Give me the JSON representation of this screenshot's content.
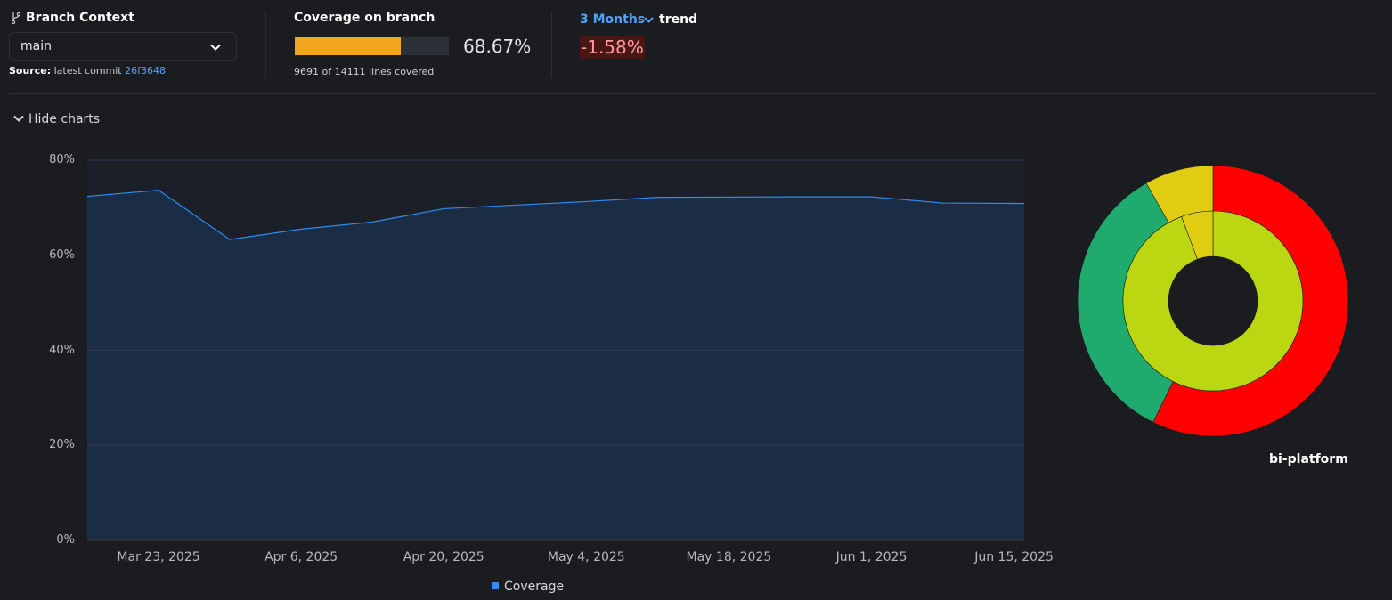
{
  "branch": {
    "title": "Branch Context",
    "selected": "main",
    "source_label": "Source:",
    "source_text": "latest commit",
    "commit": "26f3648"
  },
  "coverage": {
    "title": "Coverage on branch",
    "percent_text": "68.67%",
    "fraction": 0.6867,
    "lines_text": "9691 of 14111 lines covered",
    "bar_color": "#f4a51e"
  },
  "trend": {
    "period": "3 Months",
    "label": "trend",
    "value": "-1.58%"
  },
  "charts": {
    "toggle_label": "Hide charts",
    "legend": "Coverage"
  },
  "sunburst": {
    "label": "bi-platform"
  },
  "chart_data": [
    {
      "type": "area",
      "title": "",
      "xlabel": "",
      "ylabel": "",
      "ylim": [
        0,
        80
      ],
      "y_ticks": [
        "0%",
        "20%",
        "40%",
        "60%",
        "80%"
      ],
      "x_ticks": [
        "Mar 23, 2025",
        "Apr 6, 2025",
        "Apr 20, 2025",
        "May 4, 2025",
        "May 18, 2025",
        "Jun 1, 2025",
        "Jun 15, 2025"
      ],
      "x_range": [
        "2025-03-16",
        "2025-06-16"
      ],
      "grid": true,
      "legend_position": "bottom",
      "series": [
        {
          "name": "Coverage",
          "color": "#2e8bf0",
          "points": [
            {
              "x": "2025-03-16",
              "y": 72.4
            },
            {
              "x": "2025-03-23",
              "y": 73.7
            },
            {
              "x": "2025-03-30",
              "y": 63.3
            },
            {
              "x": "2025-04-06",
              "y": 65.5
            },
            {
              "x": "2025-04-13",
              "y": 67.0
            },
            {
              "x": "2025-04-20",
              "y": 69.8
            },
            {
              "x": "2025-05-04",
              "y": 71.3
            },
            {
              "x": "2025-05-11",
              "y": 72.2
            },
            {
              "x": "2025-05-25",
              "y": 72.3
            },
            {
              "x": "2025-06-01",
              "y": 72.3
            },
            {
              "x": "2025-06-08",
              "y": 71.0
            },
            {
              "x": "2025-06-16",
              "y": 70.9
            }
          ]
        }
      ]
    },
    {
      "type": "pie",
      "title": "",
      "rings": [
        {
          "name": "outer",
          "slices": [
            {
              "value": 0.573,
              "color": "#ff0000"
            },
            {
              "value": 0.345,
              "color": "#1fab6e"
            },
            {
              "value": 0.082,
              "color": "#e0cd11"
            }
          ]
        },
        {
          "name": "inner",
          "slices": [
            {
              "value": 0.943,
              "color": "#bad712"
            },
            {
              "value": 0.057,
              "color": "#e0cd11"
            }
          ]
        }
      ]
    }
  ]
}
